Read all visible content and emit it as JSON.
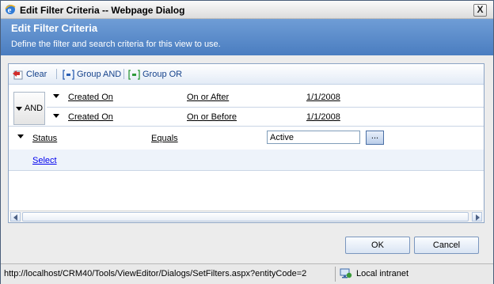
{
  "window": {
    "title": "Edit Filter Criteria -- Webpage Dialog",
    "close_label": "X"
  },
  "header": {
    "title": "Edit Filter Criteria",
    "description": "Define the filter and search criteria for this view to use."
  },
  "toolbar": {
    "clear_label": "Clear",
    "group_and_label": "Group AND",
    "group_or_label": "Group OR"
  },
  "group": {
    "operator_label": "AND"
  },
  "conditions": [
    {
      "field": "Created On",
      "operator": "On or After",
      "value": "1/1/2008"
    },
    {
      "field": "Created On",
      "operator": "On or Before",
      "value": "1/1/2008"
    }
  ],
  "status_condition": {
    "field": "Status",
    "operator": "Equals",
    "value": "Active",
    "browse_label": "..."
  },
  "select_label": "Select",
  "buttons": {
    "ok": "OK",
    "cancel": "Cancel"
  },
  "statusbar": {
    "url": "http://localhost/CRM40/Tools/ViewEditor/Dialogs/SetFilters.aspx?entityCode=2",
    "zone": "Local intranet"
  },
  "colors": {
    "header_bg": "#5a8acb",
    "link_blue": "#0000ee",
    "toolbar_text": "#15428b"
  }
}
